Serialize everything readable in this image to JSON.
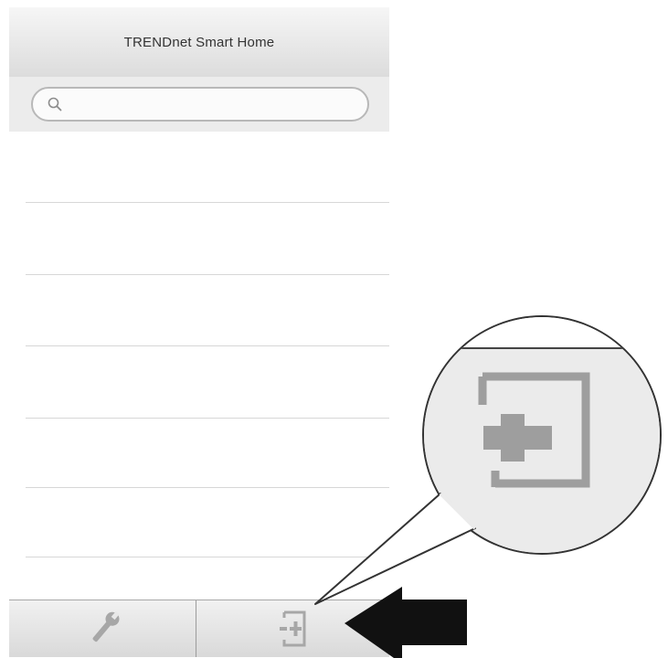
{
  "nav": {
    "title": "TRENDnet Smart Home"
  },
  "search": {
    "placeholder": "",
    "icon": "search-icon"
  },
  "list": {
    "row_count": 6
  },
  "tab_bar": {
    "items": [
      {
        "name": "settings",
        "icon": "wrench-icon"
      },
      {
        "name": "add-device",
        "icon": "add-device-icon"
      }
    ]
  },
  "callout": {
    "magnified_icon": "add-device-icon",
    "pointer": "arrow-left-icon"
  },
  "colors": {
    "nav_bar": "#e6e6e6",
    "icon_gray": "#a7a7a7",
    "arrow": "#111111"
  }
}
